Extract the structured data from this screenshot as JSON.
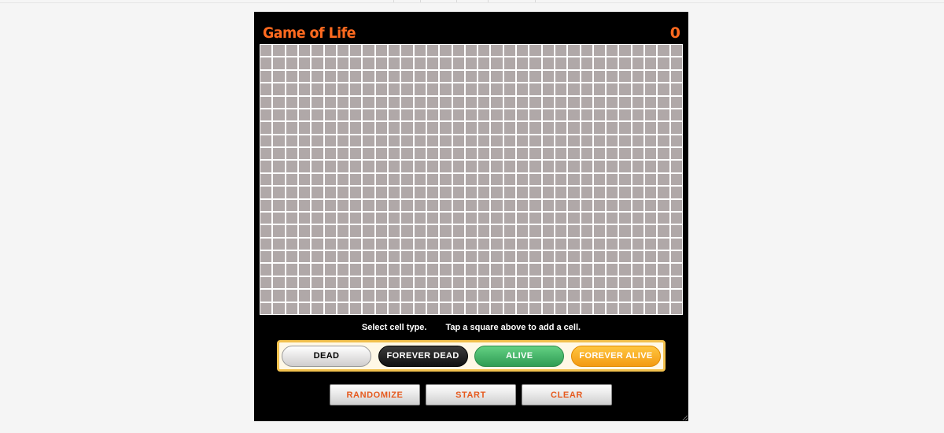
{
  "game": {
    "title": "Game of Life",
    "generation": "0",
    "grid": {
      "columns": 33,
      "rows": 21,
      "cell_state": "dead"
    }
  },
  "hint": {
    "select": "Select cell type.",
    "tap": "Tap a square above to add a cell."
  },
  "cell_types": [
    {
      "label": "DEAD",
      "selected": true
    },
    {
      "label": "FOREVER DEAD"
    },
    {
      "label": "ALIVE"
    },
    {
      "label": "FOREVER ALIVE"
    }
  ],
  "controls": {
    "randomize": "RANDOMIZE",
    "start": "START",
    "clear": "CLEAR"
  },
  "colors": {
    "accent": "#ff6a1f",
    "dead_cell": "#b0a8a8",
    "alive": "#3fb866",
    "forever_alive": "#f7a824",
    "forever_dead": "#1a1a1a"
  }
}
